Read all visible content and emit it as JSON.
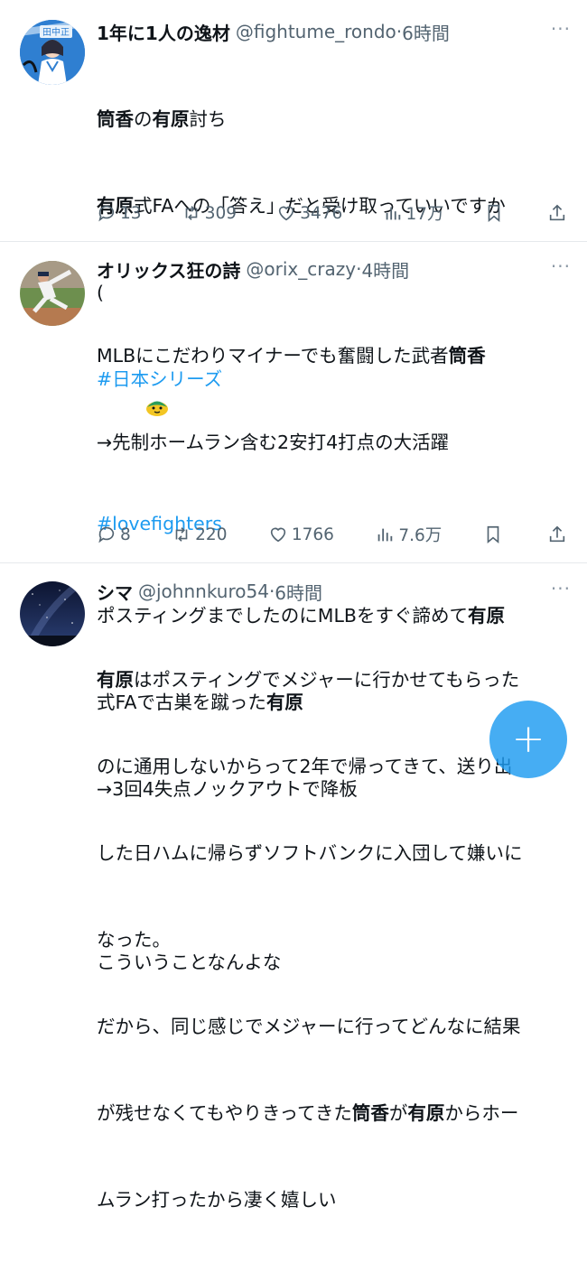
{
  "tweets": [
    {
      "name": "1年に1人の逸材",
      "handle": "@fightume_rondo",
      "time": "6時間",
      "more": "···",
      "avatar_icon": "player-illustration-avatar",
      "avatar_colors": {
        "bg": "#2f7fd1",
        "accent": "#e8f2fb"
      },
      "line1_a": "筒香",
      "line1_b": "の",
      "line1_c": "有原",
      "line1_d": "討ち",
      "line2_a": "有原",
      "line2_b": "式FAへの「答え」だと受け取っていいですか",
      "line3": "(",
      "hashtag1": "#日本シリーズ",
      "hashtag1_emoji": "hawk-emoji",
      "hashtag2": "#lovefighters",
      "replies": "13",
      "retweets": "309",
      "likes": "3476",
      "views": "17万"
    },
    {
      "name": "オリックス狂の詩",
      "handle": "@orix_crazy",
      "time": "4時間",
      "more": "···",
      "avatar_icon": "pitcher-photo-avatar",
      "line1_a": "MLBにこだわりマイナーでも奮闘した武者",
      "line1_b": "筒香",
      "line2": "→先制ホームラン含む2安打4打点の大活躍",
      "line3_a": "ポスティングまでしたのにMLBをすぐ諦めて",
      "line3_b": "有原",
      "line4_a": "式FAで古巣を蹴った",
      "line4_b": "有原",
      "line5": "→3回4失点ノックアウトで降板",
      "line6": "こういうことなんよな",
      "replies": "8",
      "retweets": "220",
      "likes": "1766",
      "views": "7.6万"
    },
    {
      "name": "シマ",
      "handle": "@johnnkuro54",
      "time": "6時間",
      "more": "···",
      "avatar_icon": "night-sky-avatar",
      "line1_a": "有原",
      "line1_b": "はポスティングでメジャーに行かせてもらった",
      "line2": "のに通用しないからって2年で帰ってきて、送り出",
      "line3": "した日ハムに帰らずソフトバンクに入団して嫌いに",
      "line4": "なった。",
      "line5": "だから、同じ感じでメジャーに行ってどんなに結果",
      "line6_a": "が残せなくてもやりきってきた",
      "line6_b": "筒香",
      "line6_c": "が",
      "line6_d": "有原",
      "line6_e": "からホー",
      "line7": "ムラン打ったから凄く嬉しい"
    }
  ],
  "separator": " · ",
  "fab": {
    "label": "+",
    "color": "#1d9bf0"
  }
}
